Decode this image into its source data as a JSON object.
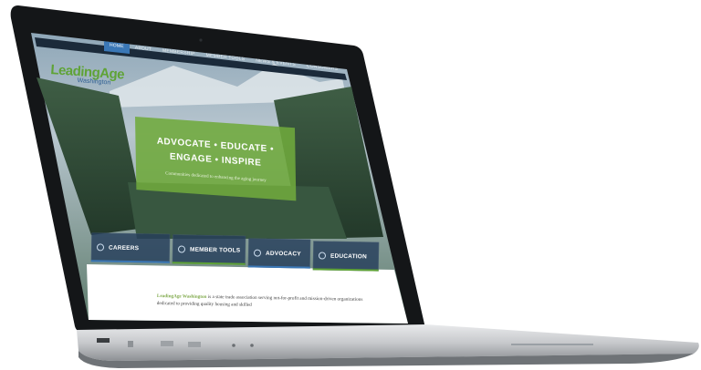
{
  "nav": {
    "items": [
      {
        "label": "HOME",
        "active": true
      },
      {
        "label": "ABOUT",
        "active": false
      },
      {
        "label": "MEMBERSHIP",
        "active": false
      },
      {
        "label": "MEMBER TOOLS",
        "active": false
      },
      {
        "label": "NEWS & EVENTS",
        "active": false
      },
      {
        "label": "CONSUMERS",
        "active": false
      },
      {
        "label": "CONTACT",
        "active": false
      }
    ]
  },
  "logo": {
    "main": "LeadingAge",
    "sub": "Washington"
  },
  "hero": {
    "line1": "ADVOCATE • EDUCATE •",
    "line2": "ENGAGE • INSPIRE",
    "subtitle": "Communities dedicated to enhancing the aging journey"
  },
  "tiles": [
    {
      "label": "CAREERS",
      "icon": "person-icon",
      "accent": "#3a77b6"
    },
    {
      "label": "MEMBER TOOLS",
      "icon": "heart-icon",
      "accent": "#5fa336"
    },
    {
      "label": "ADVOCACY",
      "icon": "megaphone-icon",
      "accent": "#3a77b6"
    },
    {
      "label": "EDUCATION",
      "icon": "book-icon",
      "accent": "#5fa336"
    }
  ],
  "intro": {
    "org": "LeadingAge Washington",
    "text": " is a state trade association serving not-for-profit and mission-driven organizations dedicated to providing quality housing and skilled"
  },
  "colors": {
    "green": "#5fa336",
    "blue": "#3a77b6",
    "navy": "#1b2a3a"
  }
}
